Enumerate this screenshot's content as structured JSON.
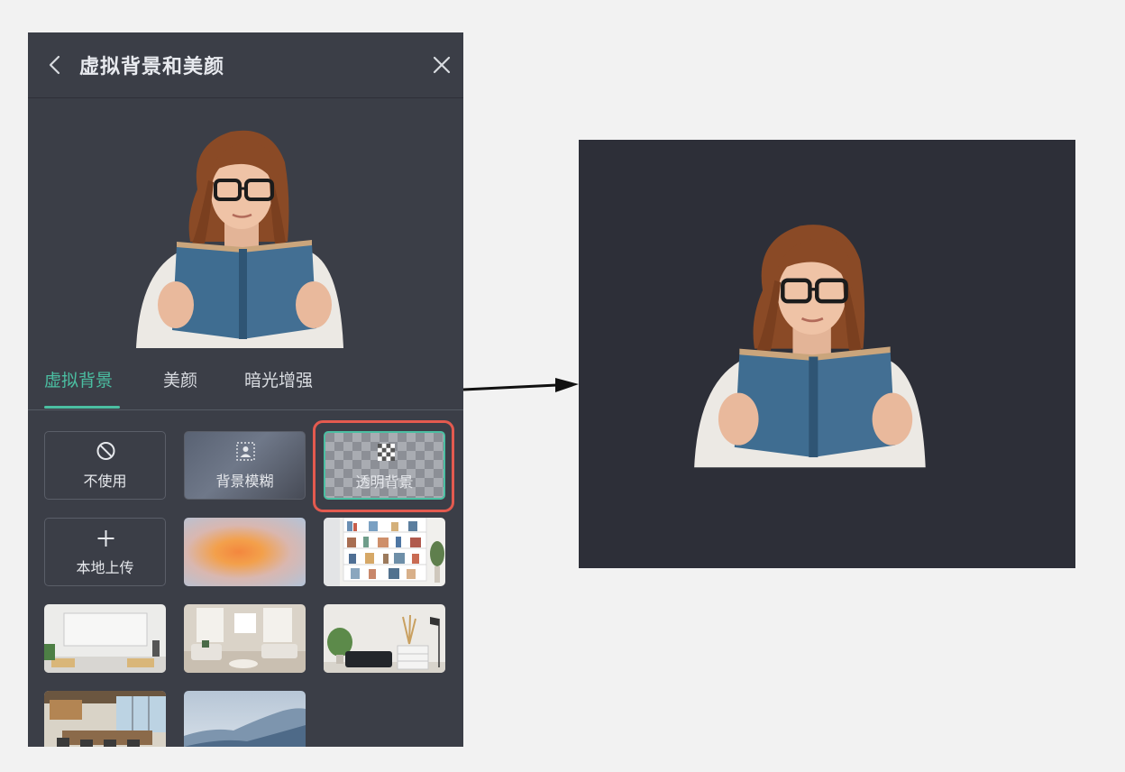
{
  "header": {
    "title": "虚拟背景和美颜"
  },
  "tabs": [
    {
      "label": "虚拟背景",
      "active": true
    },
    {
      "label": "美颜",
      "active": false
    },
    {
      "label": "暗光增强",
      "active": false
    }
  ],
  "options": {
    "none_label": "不使用",
    "blur_label": "背景模糊",
    "transparent_label": "透明背景",
    "upload_label": "本地上传"
  },
  "icons": [
    "chevron-left-icon",
    "close-icon",
    "prohibit-icon",
    "person-blur-icon",
    "checkerboard-icon",
    "plus-icon"
  ],
  "colors": {
    "panel_bg": "#3b3e47",
    "accent": "#4bbfa2",
    "highlight": "#e35a4f",
    "result_bg": "#2d2f38"
  },
  "selected_background": "透明背景"
}
